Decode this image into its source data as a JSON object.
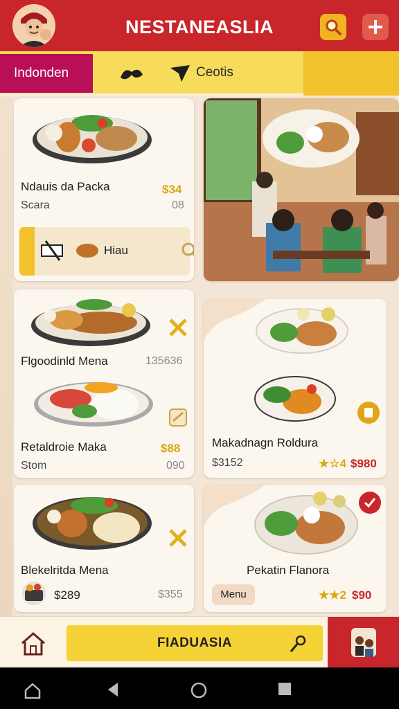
{
  "header": {
    "title": "NESTANEASLIA",
    "avatar_icon": "chef-avatar-icon",
    "search_icon": "search-icon",
    "add_icon": "plus-icon"
  },
  "tabs": {
    "active_label": "Indonden",
    "second_label": "Ceotis",
    "icon_1": "leaf-pepper-icon",
    "icon_2": "bird-icon"
  },
  "cards": [
    {
      "name": "Ndauis da Packa",
      "sub": "Scara",
      "price": "$34",
      "extra": "08",
      "strip_label": "Hiau"
    },
    {
      "name": "Flgoodinld Mena",
      "price_gray": "135636",
      "name2": "Retaldroie Maka",
      "sub2": "Stom",
      "price2": "$88",
      "extra2": "090"
    },
    {
      "name": "Makadnagn Roldura",
      "sub": "$3152",
      "rating": "★☆4",
      "price_red": "$980"
    },
    {
      "name": "Blekelritda Mena",
      "price": "$289",
      "price_gray": "$355"
    },
    {
      "name": "Pekatin Flanora",
      "menu_label": "Menu",
      "rating": "★★2",
      "price_red": "$90"
    }
  ],
  "bottom": {
    "cta_label": "FIADUASIA",
    "home_icon": "home-icon",
    "mic_icon": "microphone-icon",
    "profile_icon": "family-avatar-icon"
  },
  "colors": {
    "header_red": "#c8262b",
    "tab_magenta": "#b90f59",
    "accent_yellow": "#f5d336",
    "price_gold": "#d9a714"
  }
}
